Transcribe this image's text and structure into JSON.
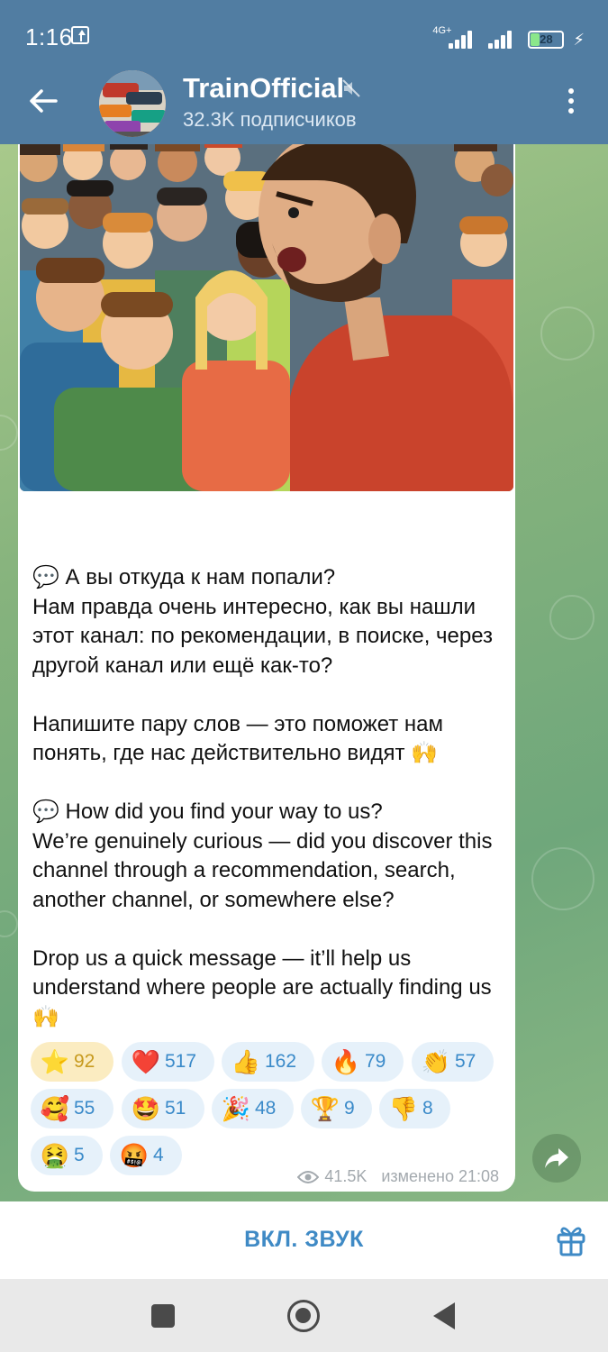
{
  "status_bar": {
    "time": "1:16",
    "network": "4G+",
    "battery": "28"
  },
  "header": {
    "channel_name": "TrainOfficial",
    "subscribers": "32.3K подписчиков"
  },
  "post": {
    "image_alt": "Cartoon illustration: a crowd of people with an angry shouting man in a red t-shirt",
    "paragraphs": [
      "💬 А вы откуда к нам попали?\nНам правда очень интересно, как вы нашли этот канал: по рекомендации, в поиске, через другой канал или ещё как-то?",
      "Напишите пару слов — это поможет нам понять, где нас действительно видят 🙌",
      "💬 How did you find your way to us?\nWe’re genuinely curious — did you discover this channel through a recommendation, search, another channel, or somewhere else?",
      "Drop us a quick message — it’ll help us understand where people are actually finding us 🙌"
    ],
    "reactions": [
      {
        "emoji": "⭐",
        "count": "92",
        "active": true
      },
      {
        "emoji": "❤️",
        "count": "517"
      },
      {
        "emoji": "👍",
        "count": "162"
      },
      {
        "emoji": "🔥",
        "count": "79"
      },
      {
        "emoji": "👏",
        "count": "57"
      },
      {
        "emoji": "🥰",
        "count": "55"
      },
      {
        "emoji": "🤩",
        "count": "51"
      },
      {
        "emoji": "🎉",
        "count": "48"
      },
      {
        "emoji": "🏆",
        "count": "9"
      },
      {
        "emoji": "👎",
        "count": "8"
      },
      {
        "emoji": "🤮",
        "count": "5"
      },
      {
        "emoji": "🤬",
        "count": "4"
      }
    ],
    "views": "41.5K",
    "edited_time": "изменено 21:08"
  },
  "bottom": {
    "sound_button": "ВКЛ. ЗВУК"
  },
  "colors": {
    "header": "#517da2",
    "accent": "#3f8ac5",
    "reaction_bg": "#e6f1fa",
    "reaction_active_bg": "#fbecc1"
  }
}
